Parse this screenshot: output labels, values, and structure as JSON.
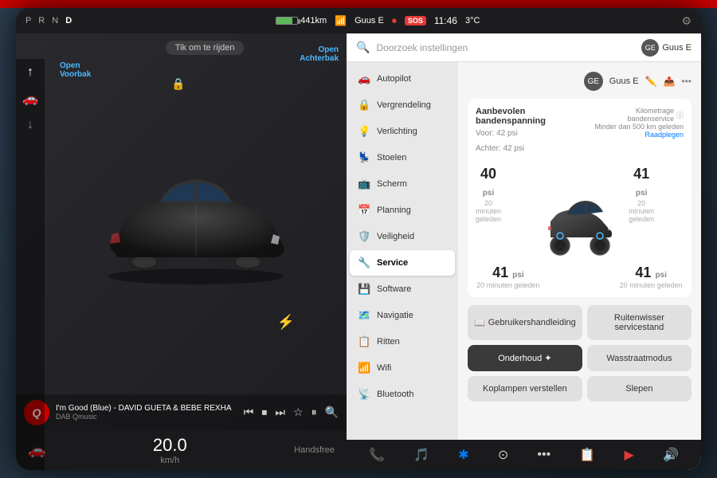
{
  "status_bar": {
    "prnd": "P R N D",
    "active_gear": "D",
    "range": "441km",
    "user": "Guus E",
    "time": "11:46",
    "temp": "3°C",
    "sos": "SOS"
  },
  "left_panel": {
    "tap_to_drive": "Tik om te rijden",
    "open_voorbak": "Open\nVoorbak",
    "open_achterbak": "Open\nAchterbak",
    "music": {
      "title": "I'm Good (Blue) - DAVID GUETA & BEBE REXHA",
      "source": "DAB Qmusic"
    },
    "speed": "20.0",
    "speed_unit": "km/h"
  },
  "settings": {
    "search_placeholder": "Doorzoek instellingen",
    "user_name": "Guus E",
    "menu_items": [
      {
        "icon": "🚗",
        "label": "Autopilot",
        "active": false
      },
      {
        "icon": "🔒",
        "label": "Vergrendeling",
        "active": false
      },
      {
        "icon": "💡",
        "label": "Verlichting",
        "active": false
      },
      {
        "icon": "💺",
        "label": "Stoelen",
        "active": false
      },
      {
        "icon": "📺",
        "label": "Scherm",
        "active": false
      },
      {
        "icon": "📅",
        "label": "Planning",
        "active": false
      },
      {
        "icon": "🛡️",
        "label": "Veiligheid",
        "active": false
      },
      {
        "icon": "🔧",
        "label": "Service",
        "active": true
      },
      {
        "icon": "💾",
        "label": "Software",
        "active": false
      },
      {
        "icon": "🗺️",
        "label": "Navigatie",
        "active": false
      },
      {
        "icon": "📋",
        "label": "Ritten",
        "active": false
      },
      {
        "icon": "📶",
        "label": "Wifi",
        "active": false
      },
      {
        "icon": "📡",
        "label": "Bluetooth",
        "active": false
      }
    ],
    "tire_section": {
      "title": "Aanbevolen bandenspanning",
      "pressure_front": "Voor: 42 psi",
      "pressure_rear": "Achter: 42 psi",
      "service_note": "Kilometrage bandenservice",
      "service_sub": "Minder dan 500 km geleden",
      "service_link": "Raadplegen",
      "readings": [
        {
          "position": "fl",
          "psi": "40",
          "unit": "psi",
          "time": "20 minuten geleden"
        },
        {
          "position": "fr",
          "psi": "41",
          "unit": "psi",
          "time": "20 minuten geleden"
        },
        {
          "position": "rl",
          "psi": "41",
          "unit": "psi",
          "time": "20 minuten geleden"
        },
        {
          "position": "rr",
          "psi": "41",
          "unit": "psi",
          "time": "20 minuten geleden"
        }
      ]
    },
    "action_buttons": [
      {
        "label": "Gebruikershandleiding",
        "icon": "📖",
        "primary": false
      },
      {
        "label": "Ruitenwisser servicestand",
        "primary": false
      },
      {
        "label": "Onderhoud ✦",
        "primary": true
      },
      {
        "label": "Wasstraatmodus",
        "primary": false
      },
      {
        "label": "Koplampen verstellen",
        "primary": false,
        "wide": true
      },
      {
        "label": "Slepen",
        "primary": false
      }
    ]
  },
  "taskbar": {
    "icons": [
      "📞",
      "🎵",
      "✱",
      "⊙",
      "•••",
      "📋",
      "▶"
    ]
  }
}
